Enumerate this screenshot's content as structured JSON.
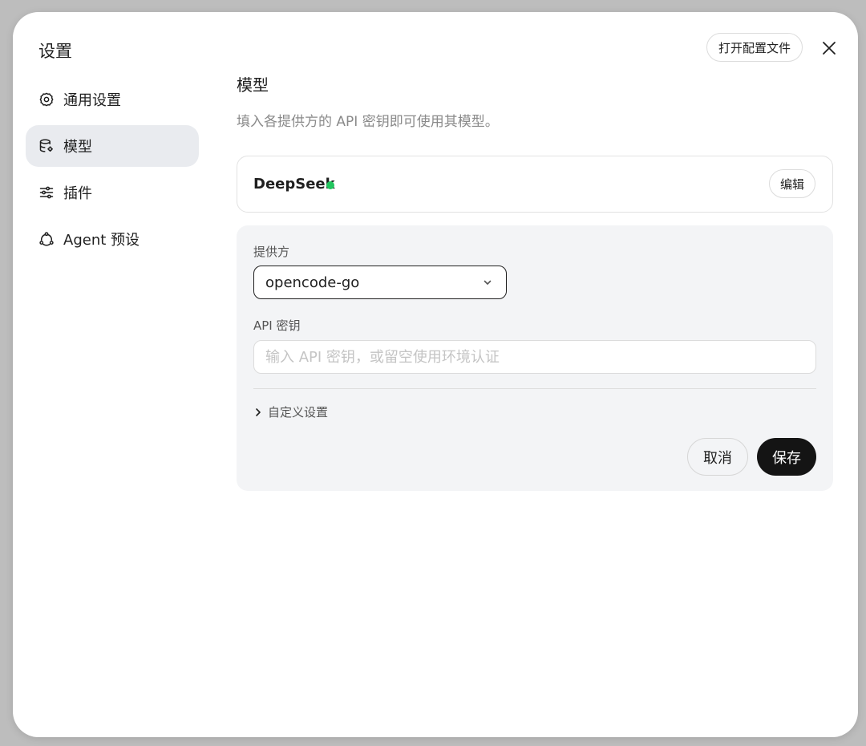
{
  "sidebar": {
    "title": "设置",
    "items": [
      {
        "label": "通用设置",
        "icon": "gear-icon",
        "active": false
      },
      {
        "label": "模型",
        "icon": "database-icon",
        "active": true
      },
      {
        "label": "插件",
        "icon": "sliders-icon",
        "active": false
      },
      {
        "label": "Agent 预设",
        "icon": "agent-icon",
        "active": false
      }
    ]
  },
  "header": {
    "open_config_label": "打开配置文件",
    "close_icon": "close-icon"
  },
  "main": {
    "title": "模型",
    "description": "填入各提供方的 API 密钥即可使用其模型。",
    "provider_card": {
      "name": "DeepSeek",
      "status_color": "#22c55e",
      "edit_label": "编辑"
    },
    "form": {
      "provider_label": "提供方",
      "provider_value": "opencode-go",
      "api_key_label": "API 密钥",
      "api_key_placeholder": "输入 API 密钥，或留空使用环境认证",
      "api_key_value": "",
      "custom_settings_label": "自定义设置",
      "cancel_label": "取消",
      "save_label": "保存"
    }
  },
  "colors": {
    "accent_dark": "#141414",
    "status_ok": "#22c55e",
    "active_nav_bg": "#e9ebef",
    "panel_bg": "#f3f4f6"
  }
}
